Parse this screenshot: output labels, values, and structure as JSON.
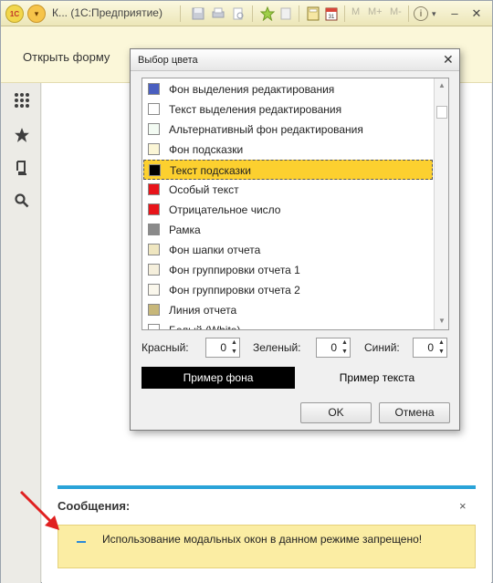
{
  "window": {
    "title": "К...  (1С:Предприятие)",
    "logo_text": "1С",
    "menu_glyph": "▾",
    "toolbar": {
      "memory_buttons": [
        "M",
        "M+",
        "M-"
      ],
      "info_glyph": "i",
      "info_menu_glyph": "▾",
      "minimize_glyph": "–",
      "close_glyph": "✕"
    }
  },
  "form_header": {
    "open_form_label": "Открыть форму"
  },
  "left_panel": {
    "icons": [
      "apps-grid-icon",
      "star-icon",
      "history-icon",
      "search-icon"
    ]
  },
  "dialog": {
    "title": "Выбор цвета",
    "close_glyph": "✕",
    "color_list": [
      {
        "label": "Фон выделения редактирования",
        "color": "#4a5fc0"
      },
      {
        "label": "Текст выделения редактирования",
        "color": "#ffffff"
      },
      {
        "label": "Альтернативный фон редактирования",
        "color": "#f3fbf3"
      },
      {
        "label": "Фон подсказки",
        "color": "#fbf6d6"
      },
      {
        "label": "Текст подсказки",
        "color": "#000000",
        "selected": true
      },
      {
        "label": "Особый текст",
        "color": "#e8141a"
      },
      {
        "label": "Отрицательное число",
        "color": "#e8141a"
      },
      {
        "label": "Рамка",
        "color": "#8a8a8a"
      },
      {
        "label": "Фон шапки отчета",
        "color": "#efe6c0"
      },
      {
        "label": "Фон группировки отчета 1",
        "color": "#f5efdc"
      },
      {
        "label": "Фон группировки отчета 2",
        "color": "#faf7ec"
      },
      {
        "label": "Линия отчета",
        "color": "#c7b77a"
      },
      {
        "label": "Белый (White)",
        "color": "#ffffff"
      }
    ],
    "red_label": "Красный:",
    "red_value": "0",
    "green_label": "Зеленый:",
    "green_value": "0",
    "blue_label": "Синий:",
    "blue_value": "0",
    "sample_background_label": "Пример фона",
    "sample_text_label": "Пример текста",
    "ok_label": "OK",
    "cancel_label": "Отмена"
  },
  "messages": {
    "title": "Сообщения:",
    "close_glyph": "×",
    "items": [
      {
        "text": "Использование модальных окон в данном режиме запрещено!"
      }
    ]
  },
  "colors": {
    "accent": "#2aa3d8",
    "selection": "#fcd02f",
    "message_bg": "#fbeda3",
    "header_bg": "#fbf7d9",
    "arrow": "#e02020"
  }
}
